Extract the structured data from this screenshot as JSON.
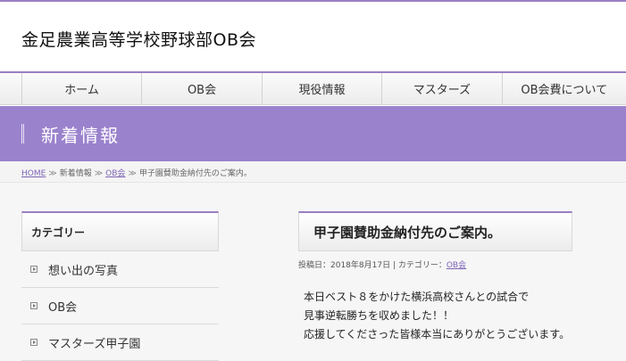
{
  "site": {
    "title": "金足農業高等学校野球部OB会"
  },
  "nav": {
    "items": [
      {
        "label": "ホーム"
      },
      {
        "label": "OB会"
      },
      {
        "label": "現役情報"
      },
      {
        "label": "マスターズ"
      },
      {
        "label": "OB会費について"
      }
    ]
  },
  "hero": {
    "title": "新着情報"
  },
  "breadcrumb": {
    "home": "HOME",
    "separator": "≫",
    "news": "新着情報",
    "ob": "OB会",
    "current": "甲子園賛助金納付先のご案内。"
  },
  "sidebar": {
    "heading": "カテゴリー",
    "items": [
      {
        "label": "想い出の写真"
      },
      {
        "label": "OB会"
      },
      {
        "label": "マスターズ甲子園"
      }
    ]
  },
  "post": {
    "title": "甲子園賛助金納付先のご案内。",
    "meta_prefix": "投稿日：2018年8月17日 | カテゴリー：",
    "meta_category": "OB会",
    "lines": [
      "本日ベスト８をかけた横浜高校さんとの試合で",
      "見事逆転勝ちを収めました！！",
      "応援してくださった皆様本当にありがとうございます。"
    ]
  },
  "colors": {
    "accent": "#9b82cd",
    "link": "#7c64b4"
  }
}
